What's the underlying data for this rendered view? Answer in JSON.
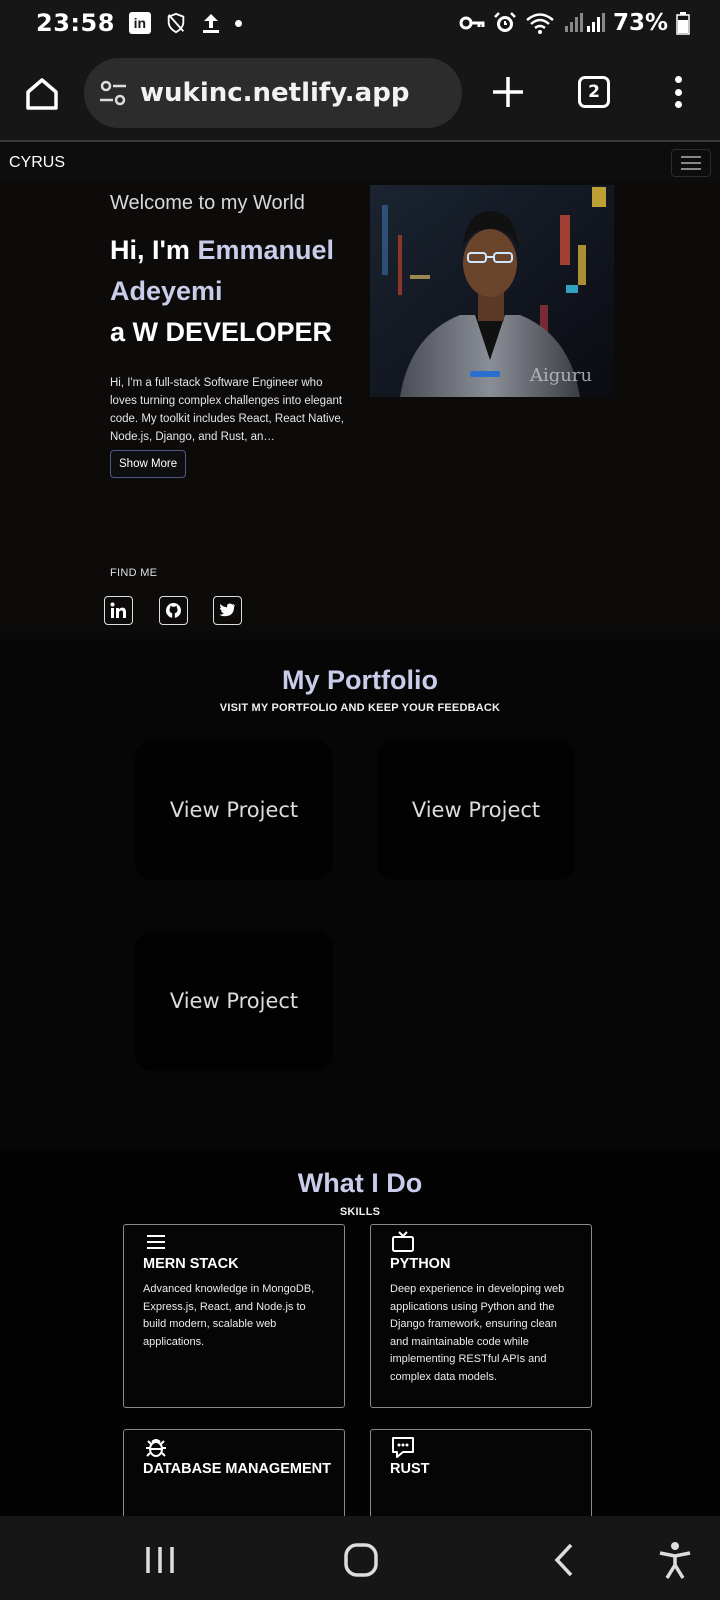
{
  "status_bar": {
    "time": "23:58",
    "linkedin_badge": "in",
    "battery": "73%",
    "icons": [
      "linkedin-icon",
      "shield-off-icon",
      "upload-icon",
      "dot-icon",
      "key-icon",
      "alarm-icon",
      "wifi-icon",
      "signal-icon",
      "battery-icon"
    ]
  },
  "browser": {
    "url": "wukinc.netlify.app",
    "tab_count": "2"
  },
  "nav": {
    "brand": "CYRUS"
  },
  "hero": {
    "welcome": "Welcome to my World",
    "greeting_prefix": "Hi, I'm ",
    "name_first": "Emmanuel",
    "name_last": "Adeyemi",
    "role_line": "a W DEVELOPER",
    "description": "Hi, I'm a full-stack Software Engineer who loves turning complex challenges into elegant code. My toolkit includes React, React Native, Node.js, Django, and Rust, an…",
    "show_more": "Show More",
    "find_me": "FIND ME",
    "photo_watermark": "Aiguru"
  },
  "portfolio": {
    "title": "My Portfolio",
    "subtitle": "VISIT MY PORTFOLIO AND KEEP YOUR FEEDBACK",
    "projects": [
      {
        "label": "View Project"
      },
      {
        "label": "View Project"
      },
      {
        "label": "View Project"
      }
    ]
  },
  "what_i_do": {
    "title": "What I Do",
    "subtitle": "SKILLS",
    "skills": [
      {
        "icon": "menu-icon",
        "title": "MERN STACK",
        "description": "Advanced knowledge in MongoDB, Express.js, React, and Node.js to build modern, scalable web applications."
      },
      {
        "icon": "tv-icon",
        "title": "PYTHON",
        "description": "Deep experience in developing web applications using Python and the Django framework, ensuring clean and maintainable code while implementing RESTful APIs and complex data models."
      },
      {
        "icon": "bug-icon",
        "title": "DATABASE MANAGEMENT",
        "description": ""
      },
      {
        "icon": "chat-icon",
        "title": "RUST",
        "description": ""
      }
    ]
  },
  "colors": {
    "accent": "#c9cdea",
    "background": "#0a0a0a",
    "chrome": "#161616"
  }
}
